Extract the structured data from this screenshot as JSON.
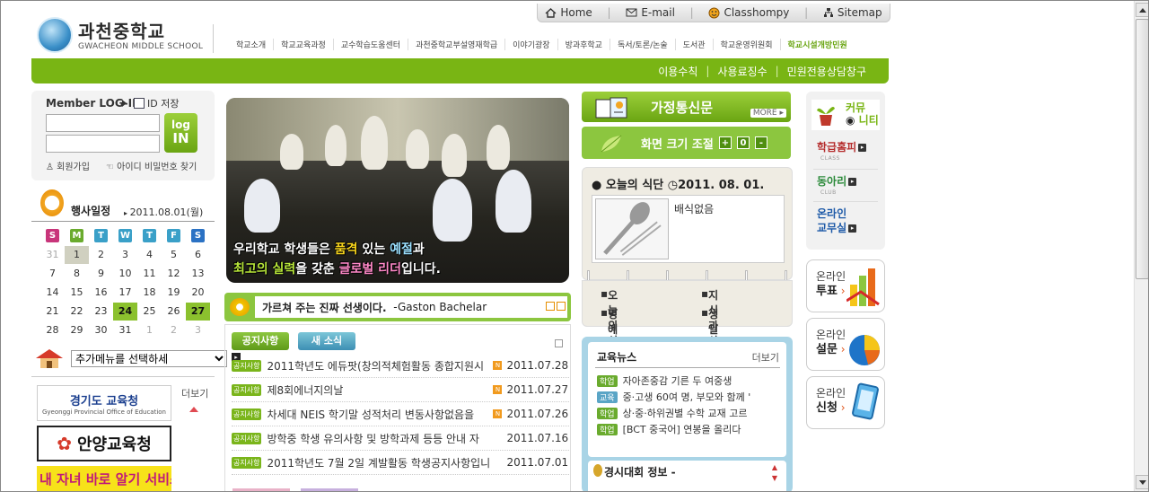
{
  "util": {
    "home": "Home",
    "email": "E-mail",
    "classhompy": "Classhompy",
    "sitemap": "Sitemap"
  },
  "logo": {
    "kr": "과천중학교",
    "en": "GWACHEON MIDDLE SCHOOL"
  },
  "gnb": [
    "학교소개",
    "학교교육과정",
    "교수학습도움센터",
    "과천중학교부설영재학급",
    "이야기광장",
    "방과후학교",
    "독서/토론/논술",
    "도서관",
    "학교운영위원회",
    "학교시설개방민원"
  ],
  "subnav": [
    "이용수칙",
    "사용료징수",
    "민원전용상담창구"
  ],
  "login": {
    "title": "Member LOG-IN",
    "save_id": "ID 저장",
    "btn1": "log",
    "btn2": "IN",
    "join": "회원가입",
    "find": "아이디 비밀번호 찾기"
  },
  "calendar": {
    "title": "행사일정",
    "date": "2011.08.01(월)",
    "headers": [
      "S",
      "M",
      "T",
      "W",
      "T",
      "F",
      "S"
    ],
    "header_colors": [
      "#c8357a",
      "#6aab2e",
      "#3aa0c8",
      "#3aa0c8",
      "#3aa0c8",
      "#3aa0c8",
      "#2b72c4"
    ],
    "weeks": [
      [
        "31",
        "1",
        "2",
        "3",
        "4",
        "5",
        "6"
      ],
      [
        "7",
        "8",
        "9",
        "10",
        "11",
        "12",
        "13"
      ],
      [
        "14",
        "15",
        "16",
        "17",
        "18",
        "19",
        "20"
      ],
      [
        "21",
        "22",
        "23",
        "24",
        "25",
        "26",
        "27"
      ],
      [
        "28",
        "29",
        "30",
        "31",
        "1",
        "2",
        "3"
      ]
    ]
  },
  "addmenu": {
    "select": "추가메뉴를 선택하세"
  },
  "banners": {
    "b1_main": "경기도 교육청",
    "b1_sub": "Gyeonggi Provincial Office of Education",
    "more": "더보기",
    "b2": "안양교육청",
    "b3": "내 자녀 바로 알기 서비스"
  },
  "photo": {
    "c1a": "우리학교 학생들은 ",
    "c1b": "품격",
    "c1c": " 있는 ",
    "c1d": "예절",
    "c1e": "과",
    "c2a": "최고의 실력",
    "c2b": "을 갖춘 ",
    "c2c": "글로벌 리더",
    "c2d": "입니다."
  },
  "quote": {
    "text": "가르쳐 주는 진짜 선생이다.",
    "author": "-Gaston Bachelar"
  },
  "notice": {
    "tab1": "공지사항",
    "tab2": "새 소식",
    "tag": "공지사항",
    "rows": [
      {
        "title": "2011학년도 에듀팟(창의적체험활동 종합지원시",
        "date": "2011.07.28",
        "new": "N"
      },
      {
        "title": "제8회에너지의날",
        "date": "2011.07.27",
        "new": "N"
      },
      {
        "title": "차세대 NEIS 학기말 성적처리 변동사항없음을",
        "date": "2011.07.26",
        "new": "N"
      },
      {
        "title": "방학중 학생 유의사항 및 방학과제 등등 안내 자",
        "date": "2011.07.16",
        "new": ""
      },
      {
        "title": "2011학년도 7월 2일 계발활동 학생공지사항입니",
        "date": "2011.07.01",
        "new": ""
      }
    ]
  },
  "home_news": {
    "title": "가정통신문",
    "more": "MORE"
  },
  "fontsize": {
    "title": "화면 크기 조절",
    "plus": "+",
    "zero": "0",
    "minus": "-"
  },
  "meal": {
    "title": "오늘의 식단",
    "date": "2011. 08. 01.",
    "text": "배식없음"
  },
  "quick": [
    "오늘의 식단",
    "지식과 상식",
    "명예의 전당",
    "생일 축하"
  ],
  "edunews": {
    "title": "교육뉴스",
    "more": "더보기",
    "rows": [
      {
        "tag": "학업",
        "text": "자아존중감 기른 두 여중생"
      },
      {
        "tag": "교육",
        "text": "중·고생 60여 명, 부모와 함께 '"
      },
      {
        "tag": "학업",
        "text": "상·중·하위권별 수학 교재 고르"
      },
      {
        "tag": "학업",
        "text": "[BCT 중국어] 연봉을 올리다"
      }
    ],
    "contest": "경시대회 정보 -"
  },
  "community": {
    "title1": "커뮤",
    "title2": "니티",
    "items": [
      {
        "label": "학급홈피",
        "sub": "CLASS"
      },
      {
        "label": "동아리",
        "sub": "CLUB"
      },
      {
        "label1": "온라인",
        "label2": "교무실"
      }
    ]
  },
  "online": [
    {
      "l1": "온라인",
      "l2": "투표"
    },
    {
      "l1": "온라인",
      "l2": "설문"
    },
    {
      "l1": "온라인",
      "l2": "신청"
    }
  ]
}
